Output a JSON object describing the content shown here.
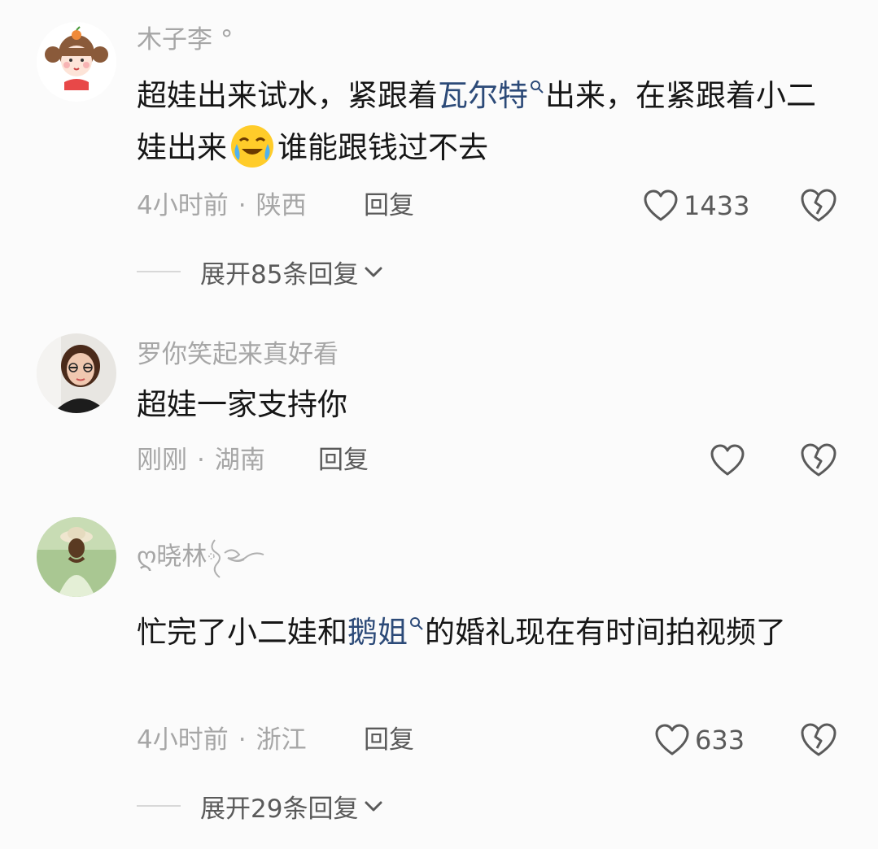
{
  "comments": [
    {
      "username": "木子李 °",
      "text_before": "超娃出来试水，紧跟着",
      "keyword": "瓦尔特",
      "text_after": "出来，在紧跟着小二娃出来",
      "text_end": "谁能跟钱过不去",
      "emoji_icon": "crying-laughing-emoji",
      "time": "4小时前",
      "location": "陕西",
      "reply_label": "回复",
      "likes": "1433",
      "expand_label": "展开85条回复"
    },
    {
      "username": "罗你笑起来真好看",
      "text": "超娃一家支持你",
      "time": "刚刚",
      "location": "湖南",
      "reply_label": "回复",
      "likes": ""
    },
    {
      "username": "ღ晓林",
      "text_before": "忙完了小二娃和",
      "keyword": "鹅姐",
      "text_after": "的婚礼现在有时间拍视频了",
      "time": "4小时前",
      "location": "浙江",
      "reply_label": "回复",
      "likes": "633",
      "expand_label": "展开29条回复"
    }
  ],
  "separator": "·",
  "colors": {
    "background": "#fbfbfb",
    "keyword": "#2c4a78",
    "muted": "#a6a6a6",
    "secondary": "#5a5a5a"
  }
}
